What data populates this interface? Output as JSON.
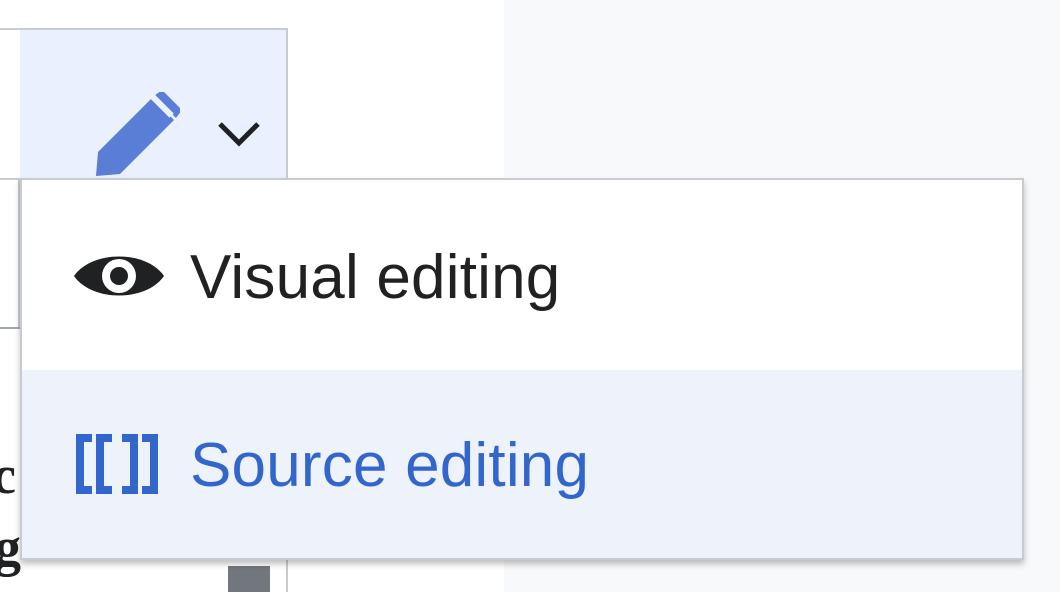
{
  "edit_toolbar": {
    "edit_icon": "pencil-icon",
    "dropdown_icon": "chevron-down-icon",
    "accent_color": "#5a7ed6",
    "button_bg": "#eaf0fd"
  },
  "menu": {
    "items": [
      {
        "label": "Visual editing",
        "icon": "eye-icon",
        "color": "#202122",
        "selected": false
      },
      {
        "label": "Source editing",
        "icon": "wikitext-brackets-icon",
        "icon_text": "[[ ]]",
        "color": "#3366cc",
        "selected": true
      }
    ]
  },
  "background_text": {
    "fragment_1": "c",
    "fragment_2": "g"
  }
}
